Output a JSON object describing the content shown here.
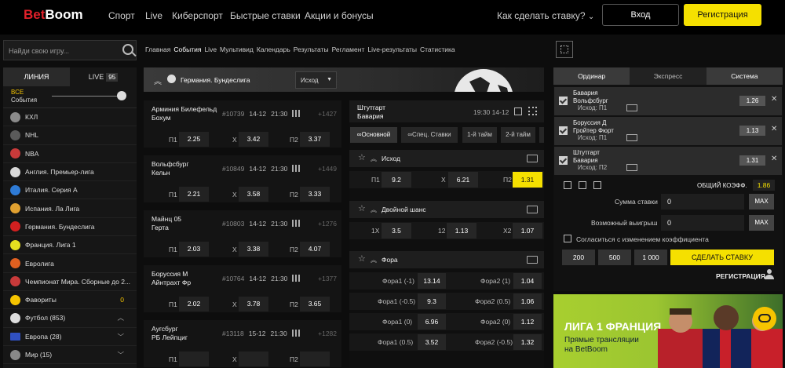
{
  "header": {
    "logo_a": "Bet",
    "logo_b": "Boom",
    "nav": [
      "Спорт",
      "Live",
      "Киберспорт",
      "Быстрые ставки",
      "Акции и бонусы"
    ],
    "howto": "Как сделать ставку?",
    "login": "Вход",
    "register": "Регистрация"
  },
  "sidebar": {
    "search_placeholder": "Найди свою игру...",
    "tab_line": "ЛИНИЯ",
    "tab_live": "LIVE",
    "live_count": "95",
    "all_events_1": "ВСЕ",
    "all_events_2": "События",
    "items": [
      {
        "label": "КХЛ",
        "color": "#8a8a8a"
      },
      {
        "label": "NHL",
        "color": "#5a5a5a"
      },
      {
        "label": "NBA",
        "color": "#c83a3a"
      },
      {
        "label": "Англия. Премьер-лига",
        "color": "#d8d8d8"
      },
      {
        "label": "Италия. Серия А",
        "color": "#2e7bd6"
      },
      {
        "label": "Испания. Ла Лига",
        "color": "#e0a030"
      },
      {
        "label": "Германия. Бундеслига",
        "color": "#d22020"
      },
      {
        "label": "Франция. Лига 1",
        "color": "#e6e020"
      },
      {
        "label": "Евролига",
        "color": "#e06020"
      },
      {
        "label": "Чемпионат Мира. Сборные до 2...",
        "color": "#c83a3a"
      },
      {
        "label": "Фавориты",
        "color": "#f5c400",
        "count": "0"
      },
      {
        "label": "Футбол (853)",
        "color": "#dddddd"
      },
      {
        "label": "Европа (28)",
        "color": "#3050c0"
      },
      {
        "label": "Мир (15)",
        "color": "#888888"
      }
    ]
  },
  "breadcrumbs": [
    "Главная",
    "События",
    "Live",
    "Мультивид",
    "Календарь",
    "Результаты",
    "Регламент",
    "Live-результаты",
    "Статистика"
  ],
  "league": {
    "name": "Германия. Бундеслига",
    "market": "Исход"
  },
  "matches": [
    {
      "t1": "Арминия Билефельд",
      "t2": "Бохум",
      "id": "#10739",
      "date": "14-12",
      "time": "21:30",
      "more": "+1427",
      "p1": "2.25",
      "x": "3.42",
      "p2": "3.37"
    },
    {
      "t1": "Вольфсбург",
      "t2": "Кельн",
      "id": "#10849",
      "date": "14-12",
      "time": "21:30",
      "more": "+1449",
      "p1": "2.21",
      "x": "3.58",
      "p2": "3.33"
    },
    {
      "t1": "Майнц 05",
      "t2": "Герта",
      "id": "#10803",
      "date": "14-12",
      "time": "21:30",
      "more": "+1276",
      "p1": "2.03",
      "x": "3.38",
      "p2": "4.07"
    },
    {
      "t1": "Боруссия М",
      "t2": "Айнтрахт Фр",
      "id": "#10764",
      "date": "14-12",
      "time": "21:30",
      "more": "+1377",
      "p1": "2.02",
      "x": "3.78",
      "p2": "3.65"
    },
    {
      "t1": "Аугсбург",
      "t2": "РБ Лейпциг",
      "id": "#13118",
      "date": "15-12",
      "time": "21:30",
      "more": "+1282",
      "p1": "",
      "x": "",
      "p2": ""
    }
  ],
  "odds_labels": {
    "p1": "П1",
    "x": "X",
    "p2": "П2"
  },
  "detail": {
    "t1": "Штутгарт",
    "t2": "Бавария",
    "time": "19:30",
    "date": "14-12",
    "tabs": [
      "Основной",
      "Спец. Ставки",
      "1-й тайм",
      "2-й тайм"
    ],
    "outcome": {
      "title": "Исход",
      "p1": "9.2",
      "x": "6.21",
      "p2": "1.31"
    },
    "double": {
      "title": "Двойной шанс",
      "l1": "1X",
      "v1": "3.5",
      "l2": "12",
      "v2": "1.13",
      "l3": "X2",
      "v3": "1.07"
    },
    "fora": {
      "title": "Фора",
      "rows": [
        [
          "Фора1 (-1)",
          "13.14",
          "Фора2 (1)",
          "1.04"
        ],
        [
          "Фора1 (-0.5)",
          "9.3",
          "Фора2 (0.5)",
          "1.06"
        ],
        [
          "Фора1 (0)",
          "6.96",
          "Фора2 (0)",
          "1.12"
        ],
        [
          "Фора1 (0.5)",
          "3.52",
          "Фора2 (-0.5)",
          "1.32"
        ]
      ]
    }
  },
  "betslip": {
    "tabs": [
      "Ординар",
      "Экспресс",
      "Система"
    ],
    "items": [
      {
        "l1": "Бавария",
        "l2": "Вольфсбург",
        "out": "Исход: П1",
        "k": "1.26"
      },
      {
        "l1": "Боруссия Д",
        "l2": "Гройтер Фюрт",
        "out": "Исход: П1",
        "k": "1.13"
      },
      {
        "l1": "Штутгарт",
        "l2": "Бавария",
        "out": "Исход: П2",
        "k": "1.31"
      }
    ],
    "total_label": "ОБЩИЙ КОЭФФ.",
    "total": "1.86",
    "stake_label": "Сумма ставки",
    "stake": "0",
    "win_label": "Возможный выигрыш",
    "win": "0",
    "max": "MAX",
    "agree": "Согласиться с изменением коэффициента",
    "quick": [
      "200",
      "500",
      "1 000"
    ],
    "make": "СДЕЛАТЬ СТАВКУ",
    "reg": "РЕГИСТРАЦИЯ"
  },
  "banner": {
    "title": "ЛИГА 1 ФРАНЦИЯ",
    "sub1": "Прямые трансляции",
    "sub2": "на BetBoom"
  }
}
